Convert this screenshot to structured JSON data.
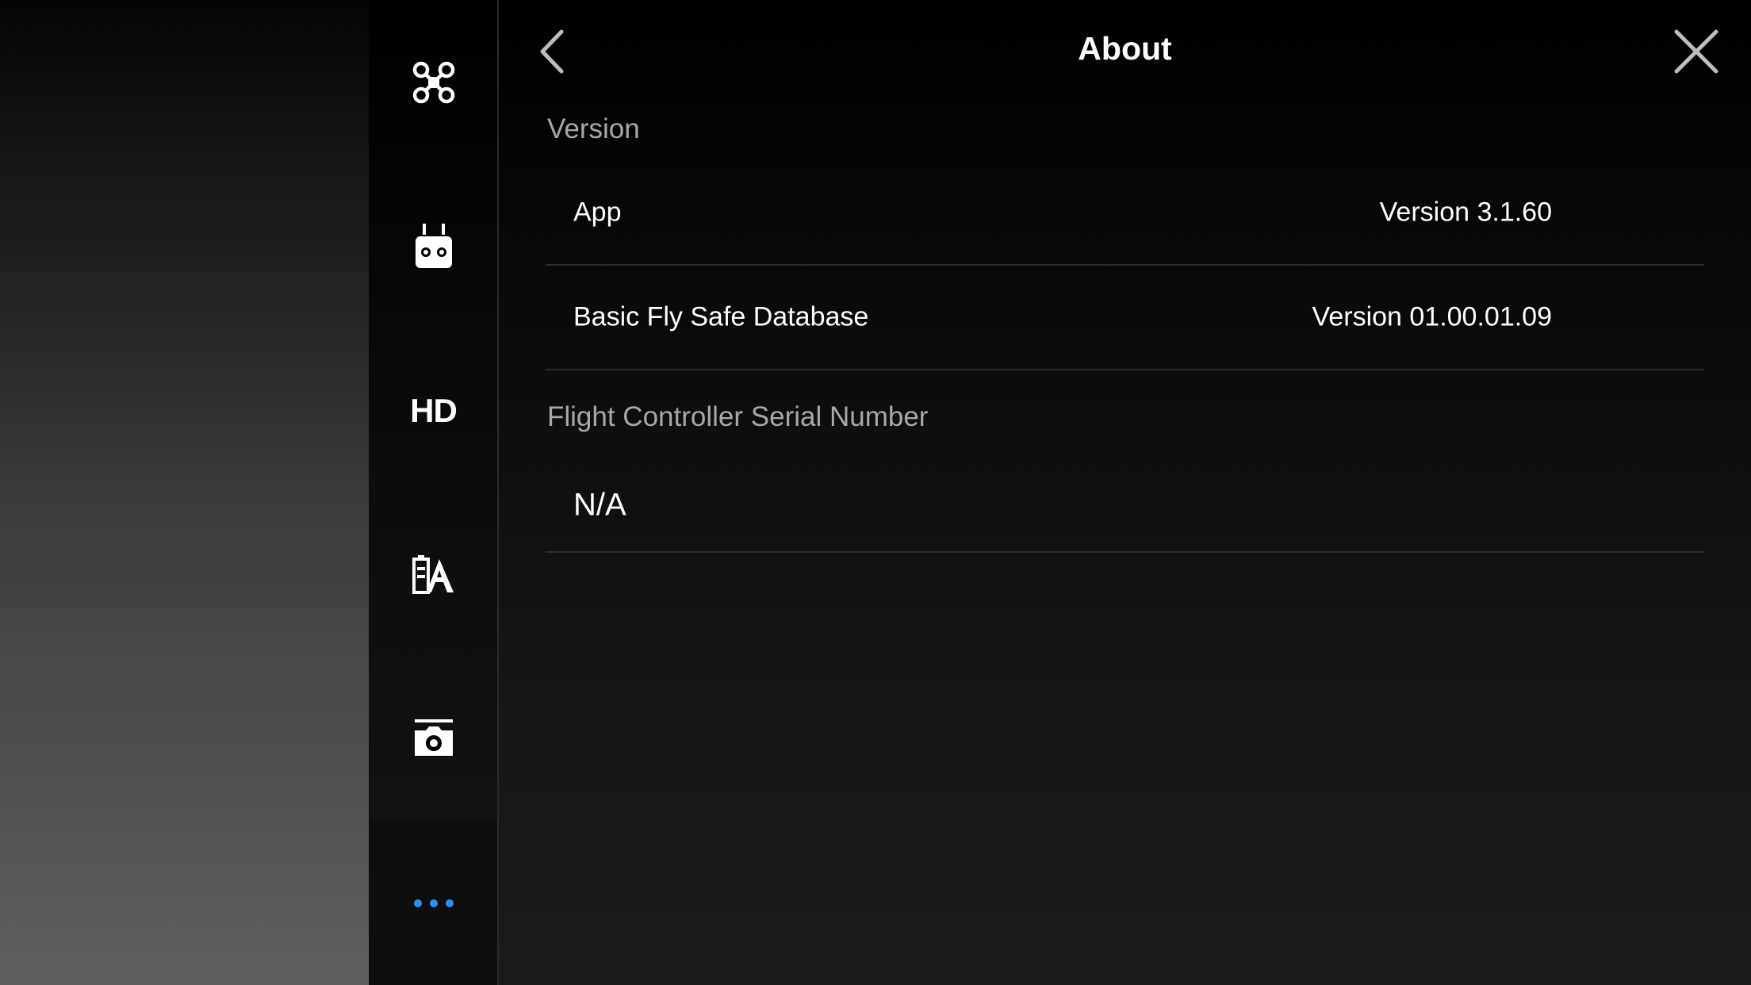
{
  "header": {
    "title": "About"
  },
  "sidebar": {
    "items": [
      {
        "icon": "aircraft-icon"
      },
      {
        "icon": "remote-controller-icon"
      },
      {
        "icon": "hd-icon",
        "label": "HD"
      },
      {
        "icon": "battery-text-icon"
      },
      {
        "icon": "camera-icon"
      },
      {
        "icon": "more-icon",
        "active": true
      }
    ],
    "accent_color": "#2a8ff0"
  },
  "version_section": {
    "label": "Version",
    "rows": [
      {
        "label": "App",
        "value": "Version  3.1.60"
      },
      {
        "label": "Basic Fly Safe Database",
        "value": "Version  01.00.01.09"
      }
    ]
  },
  "serial_section": {
    "label": "Flight Controller Serial Number",
    "value": "N/A"
  }
}
